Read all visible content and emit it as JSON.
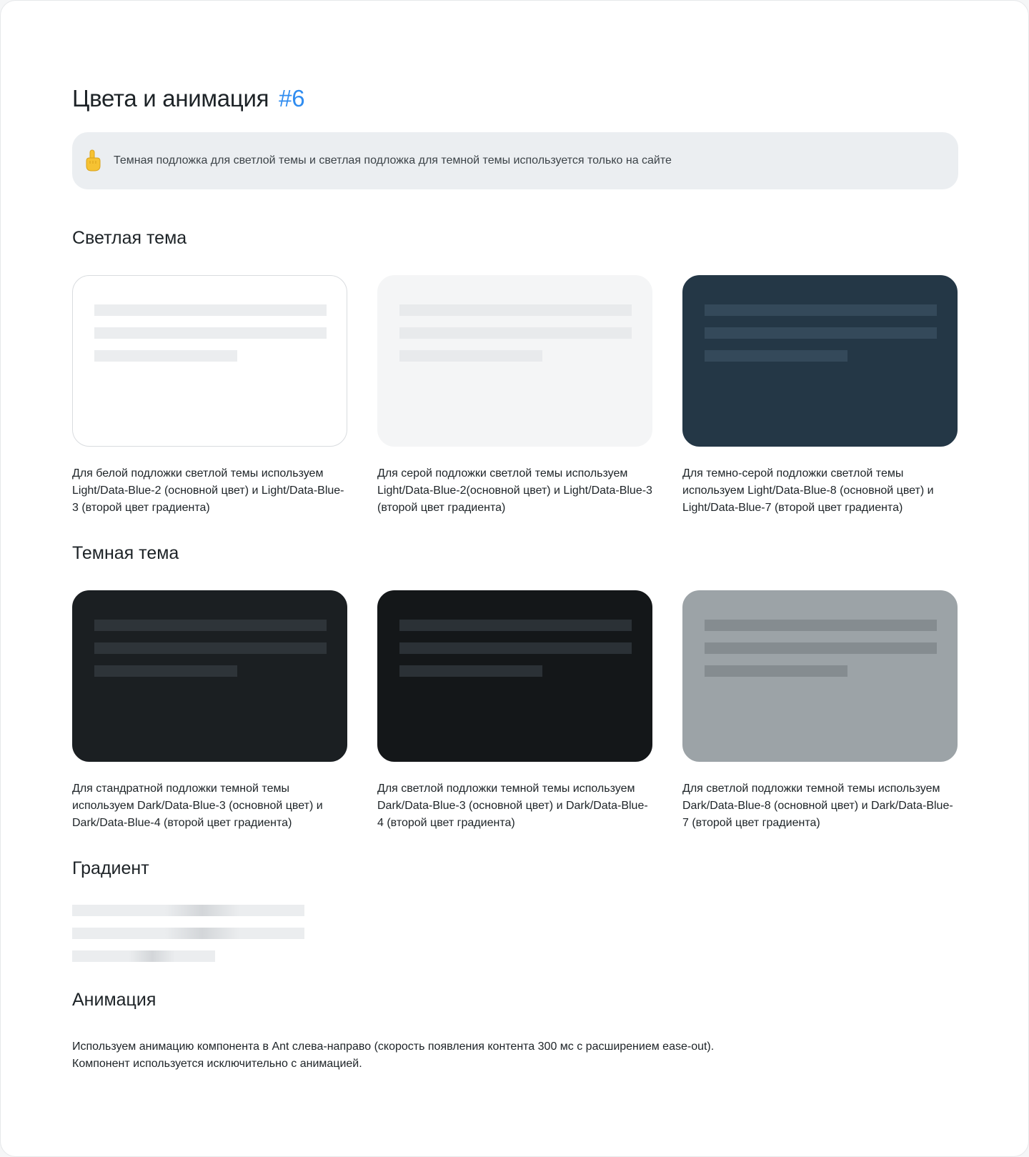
{
  "header": {
    "title": "Цвета и анимация",
    "number": "#6"
  },
  "note": {
    "icon": "pointing-up-hand-icon",
    "text": "Темная подложка для светлой темы и светлая подложка для темной темы используется только на сайте"
  },
  "light_theme": {
    "title": "Светлая тема",
    "cards": [
      {
        "background": "#ffffff",
        "border": "#d9dcdf",
        "line_color": "#ebedef",
        "caption": "Для белой подложки светлой темы используем Light/Data-Blue-2 (основной цвет) и  Light/Data-Blue-3 (второй цвет градиента)"
      },
      {
        "background": "#f4f5f6",
        "border": "#f4f5f6",
        "line_color": "#e8eaec",
        "caption": "Для серой подложки светлой темы используем Light/Data-Blue-2(основной цвет) и  Light/Data-Blue-3 (второй цвет градиента)"
      },
      {
        "background": "#243746",
        "border": "#243746",
        "line_color": "#34495a",
        "caption": "Для темно-серой подложки светлой темы используем   Light/Data-Blue-8 (основной цвет) и Light/Data-Blue-7 (второй цвет градиента)"
      }
    ]
  },
  "dark_theme": {
    "title": "Темная  тема",
    "cards": [
      {
        "background": "#1b1f22",
        "border": "#1b1f22",
        "line_color": "#2e3439",
        "caption": "Для стандратной подложки темной темы используем   Dark/Data-Blue-3 (основной цвет) и Dark/Data-Blue-4 (второй цвет градиента)"
      },
      {
        "background": "#141719",
        "border": "#141719",
        "line_color": "#2b3136",
        "caption": "Для светлой подложки темной темы используем Dark/Data-Blue-3 (основной цвет) и   Dark/Data-Blue-4 (второй цвет градиента)"
      },
      {
        "background": "#9ca3a7",
        "border": "#9ca3a7",
        "line_color": "#858c90",
        "caption": "Для светлой подложки темной темы используем Dark/Data-Blue-8 (основной цвет) и   Dark/Data-Blue-7 (второй цвет градиента)"
      }
    ]
  },
  "gradient": {
    "title": "Градиент"
  },
  "animation": {
    "title": "Анимация",
    "lines": [
      "Используем анимацию компонента в Ant слева-направо (скорость появления контента 300 мс с расширением ease-out).",
      "Компонент используется исключительно с анимацией."
    ]
  }
}
